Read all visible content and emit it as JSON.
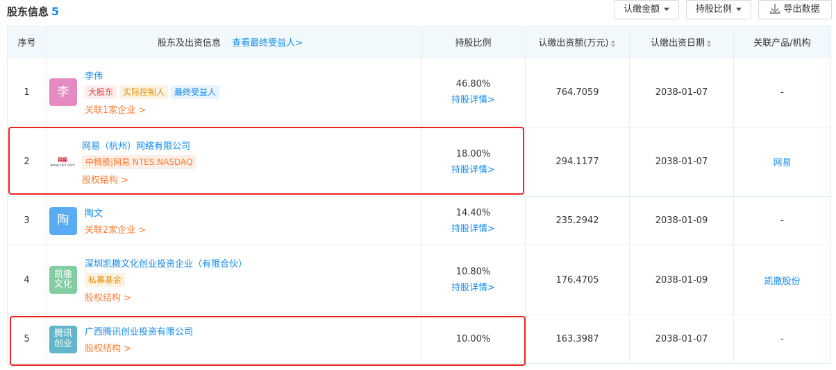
{
  "header": {
    "title": "股东信息",
    "count": "5",
    "btn_amount": "认缴金额",
    "btn_ratio": "持股比例",
    "btn_export": "导出数据"
  },
  "columns": {
    "idx": "序号",
    "info": "股东及出资信息",
    "info_link": "查看最终受益人>",
    "ratio": "持股比例",
    "amount": "认缴出资额(万元)",
    "date": "认缴出资日期",
    "product": "关联产品/机构"
  },
  "rows": [
    {
      "idx": "1",
      "avatar": "李",
      "avatar_color": "#e68bc1",
      "name": "李伟",
      "tags": [
        "大股东",
        "实际控制人",
        "最终受益人"
      ],
      "sub_link": "关联1家企业 >",
      "ratio": "46.80%",
      "detail": "持股详情>",
      "amount": "764.7059",
      "date": "2038-01-07",
      "product": "-"
    },
    {
      "idx": "2",
      "logo_text": "网易",
      "logo_sub": "www.163.com",
      "name": "网易（杭州）网络有限公司",
      "tags": [
        "中概股|网易 NTES.NASDAQ"
      ],
      "sub_link": "股权结构 >",
      "ratio": "18.00%",
      "detail": "持股详情>",
      "amount": "294.1177",
      "date": "2038-01-07",
      "product": "网易"
    },
    {
      "idx": "3",
      "avatar": "陶",
      "avatar_color": "#5aacf2",
      "name": "陶文",
      "sub_link": "关联2家企业 >",
      "ratio": "14.40%",
      "detail": "持股详情>",
      "amount": "235.2942",
      "date": "2038-01-09",
      "product": "-"
    },
    {
      "idx": "4",
      "avatar": "凯撒文化",
      "avatar_color": "#83cda3",
      "name": "深圳凯撒文化创业投资企业（有限合伙）",
      "tags": [
        "私募基金"
      ],
      "sub_link": "股权结构 >",
      "ratio": "10.80%",
      "detail": "持股详情>",
      "amount": "176.4705",
      "date": "2038-01-09",
      "product": "凯撒股份"
    },
    {
      "idx": "5",
      "avatar": "腾讯创业",
      "avatar_color": "#62b6c9",
      "name": "广西腾讯创业投资有限公司",
      "sub_link": "股权结构 >",
      "ratio": "10.00%",
      "amount": "163.3987",
      "date": "2038-01-07",
      "product": "-"
    }
  ]
}
